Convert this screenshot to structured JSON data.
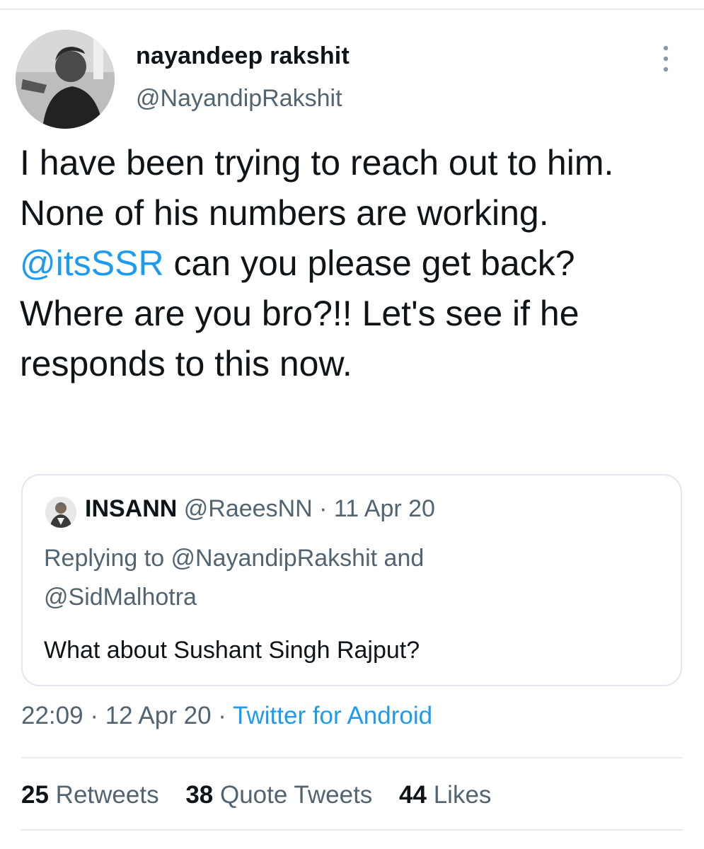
{
  "author": {
    "display_name": "nayandeep rakshit",
    "handle": "@NayandipRakshit"
  },
  "tweet": {
    "line1": "I have been trying to reach out to him.",
    "line2": "None of his numbers are working.",
    "mention": "@itsSSR",
    "line3_rest": " can you please get back? Where are you bro?!! Let's see if he responds to this now."
  },
  "quoted_tweet": {
    "name": "INSANN",
    "handle": "@RaeesNN",
    "separator": " · ",
    "date": "11 Apr 20",
    "reply_prefix": "Replying to ",
    "reply_user1": "@NayandipRakshit",
    "reply_and": " and ",
    "reply_user2": "@SidMalhotra",
    "text": "What about Sushant Singh Rajput?"
  },
  "meta": {
    "time": "22:09",
    "separator": " · ",
    "date": "12 Apr 20",
    "source": "Twitter for Android"
  },
  "stats": [
    {
      "count": "25",
      "label": "Retweets"
    },
    {
      "count": "38",
      "label": "Quote Tweets"
    },
    {
      "count": "44",
      "label": "Likes"
    }
  ],
  "colors": {
    "accent": "#1d9bf0",
    "secondary_text": "#536471",
    "divider": "#e6ecf0"
  },
  "icons": {
    "more_menu": "more-vertical-icon"
  }
}
